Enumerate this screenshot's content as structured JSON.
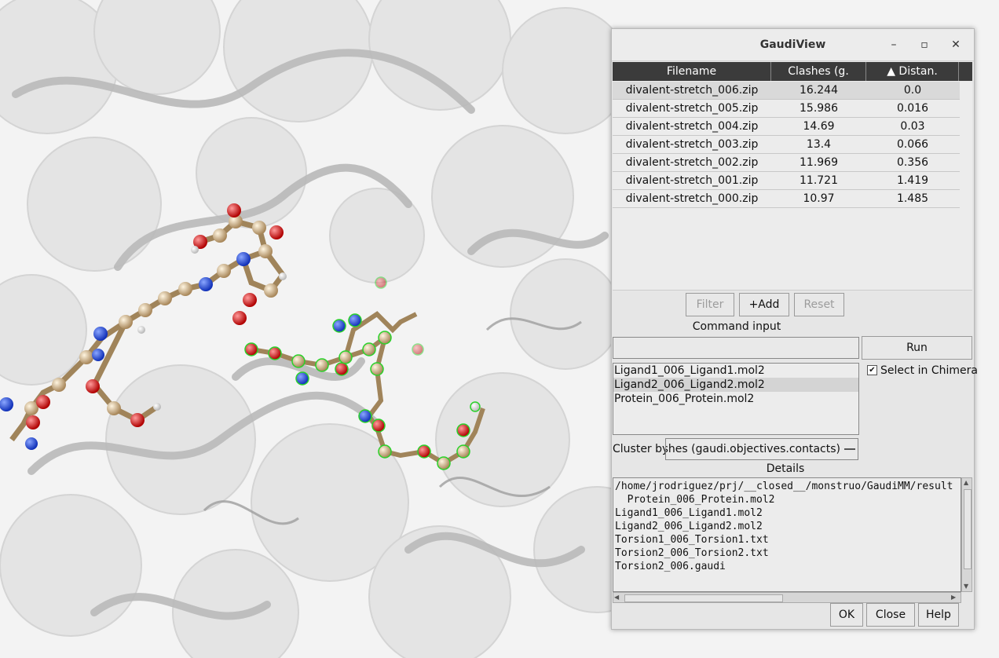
{
  "window": {
    "title": "GaudiView",
    "controls": {
      "minimize": "–",
      "maximize": "▫",
      "close": "✕"
    }
  },
  "table": {
    "columns": [
      "Filename",
      "Clashes (g.",
      "▲ Distan."
    ],
    "rows": [
      {
        "file": "divalent-stretch_006.zip",
        "clashes": "16.244",
        "distance": "0.0"
      },
      {
        "file": "divalent-stretch_005.zip",
        "clashes": "15.986",
        "distance": "0.016"
      },
      {
        "file": "divalent-stretch_004.zip",
        "clashes": "14.69",
        "distance": "0.03"
      },
      {
        "file": "divalent-stretch_003.zip",
        "clashes": "13.4",
        "distance": "0.066"
      },
      {
        "file": "divalent-stretch_002.zip",
        "clashes": "11.969",
        "distance": "0.356"
      },
      {
        "file": "divalent-stretch_001.zip",
        "clashes": "11.721",
        "distance": "1.419"
      },
      {
        "file": "divalent-stretch_000.zip",
        "clashes": "10.97",
        "distance": "1.485"
      }
    ]
  },
  "buttons": {
    "filter": "Filter",
    "add": "+Add",
    "reset": "Reset",
    "run": "Run",
    "ok": "OK",
    "close": "Close",
    "help": "Help"
  },
  "command": {
    "label": "Command input",
    "value": ""
  },
  "molecules": [
    "Ligand1_006_Ligand1.mol2",
    "Ligand2_006_Ligand2.mol2",
    "Protein_006_Protein.mol2"
  ],
  "select_in_chimera": {
    "label": "Select in Chimera",
    "checked": true,
    "mark": "✔"
  },
  "cluster": {
    "label": "Cluster by",
    "value": "lashes (gaudi.objectives.contacts)"
  },
  "details": {
    "label": "Details",
    "lines": [
      "/home/jrodriguez/prj/__closed__/monstruo/GaudiMM/result",
      "  Protein_006_Protein.mol2",
      "Ligand1_006_Ligand1.mol2",
      "Ligand2_006_Ligand2.mol2",
      "Torsion1_006_Torsion1.txt",
      "Torsion2_006_Torsion2.txt",
      "Torsion2_006.gaudi"
    ]
  }
}
